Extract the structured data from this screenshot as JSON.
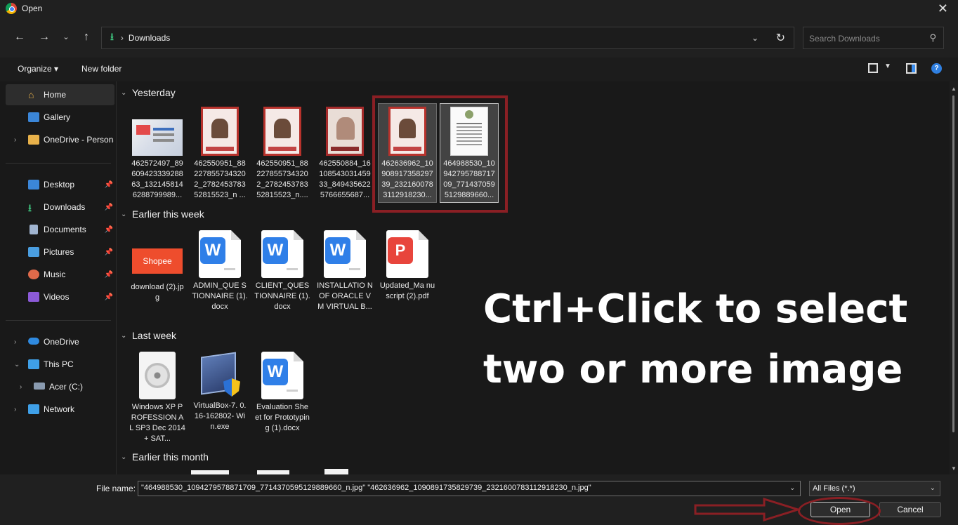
{
  "window": {
    "title": "Open"
  },
  "nav": {
    "breadcrumb": "Downloads",
    "search_placeholder": "Search Downloads"
  },
  "toolbar": {
    "organize_label": "Organize",
    "new_folder_label": "New folder"
  },
  "sidebar": {
    "items": [
      {
        "label": "Home"
      },
      {
        "label": "Gallery"
      },
      {
        "label": "OneDrive - Persona"
      },
      {
        "label": "Desktop"
      },
      {
        "label": "Downloads"
      },
      {
        "label": "Documents"
      },
      {
        "label": "Pictures"
      },
      {
        "label": "Music"
      },
      {
        "label": "Videos"
      },
      {
        "label": "OneDrive"
      },
      {
        "label": "This PC"
      },
      {
        "label": "Acer (C:)"
      },
      {
        "label": "Network"
      }
    ]
  },
  "groups": [
    {
      "label": "Yesterday",
      "files": [
        {
          "name": "462572497_89 609423339288 63_132145814 6288799989..."
        },
        {
          "name": "462550951_88 227855734320 2_2782453783 52815523_n ..."
        },
        {
          "name": "462550951_88 227855734320 2_2782453783 52815523_n...."
        },
        {
          "name": "462550884_16 108543031459 33_849435622 5766655687..."
        },
        {
          "name": "462636962_10 908917358297 39_232160078 3112918230..."
        },
        {
          "name": "464988530_10 942795788717 09_771437059 5129889660..."
        }
      ]
    },
    {
      "label": "Earlier this week",
      "files": [
        {
          "name": "download (2).jpg",
          "thumb_text": "Shopee"
        },
        {
          "name": "ADMIN_QUE STIONNAIRE (1).docx",
          "thumb_text": "W"
        },
        {
          "name": "CLIENT_QUES TIONNAIRE (1).docx",
          "thumb_text": "W"
        },
        {
          "name": "INSTALLATIO N OF ORACLE VM VIRTUAL B...",
          "thumb_text": "W"
        },
        {
          "name": "Updated_Ma nuscript (2).pdf",
          "thumb_text": "P"
        }
      ]
    },
    {
      "label": "Last week",
      "files": [
        {
          "name": "Windows XP PROFESSION AL SP3 Dec 2014 + SAT..."
        },
        {
          "name": "VirtualBox-7. 0.16-162802- Win.exe"
        },
        {
          "name": "Evaluation Sheet for Prototyping (1).docx",
          "thumb_text": "W"
        }
      ]
    },
    {
      "label": "Earlier this month",
      "files": []
    }
  ],
  "overlay": {
    "line1": "Ctrl+Click to select",
    "line2": "two or more image"
  },
  "footer": {
    "file_name_label": "File name:",
    "file_name_value": "\"464988530_1094279578871709_7714370595129889660_n.jpg\" \"462636962_1090891735829739_2321600783112918230_n.jpg\"",
    "file_type": "All Files (*.*)",
    "open_label": "Open",
    "cancel_label": "Cancel"
  },
  "colors": {
    "accent": "#2f7fe8",
    "highlight_annotation": "#8a1f24",
    "background": "#191919"
  }
}
